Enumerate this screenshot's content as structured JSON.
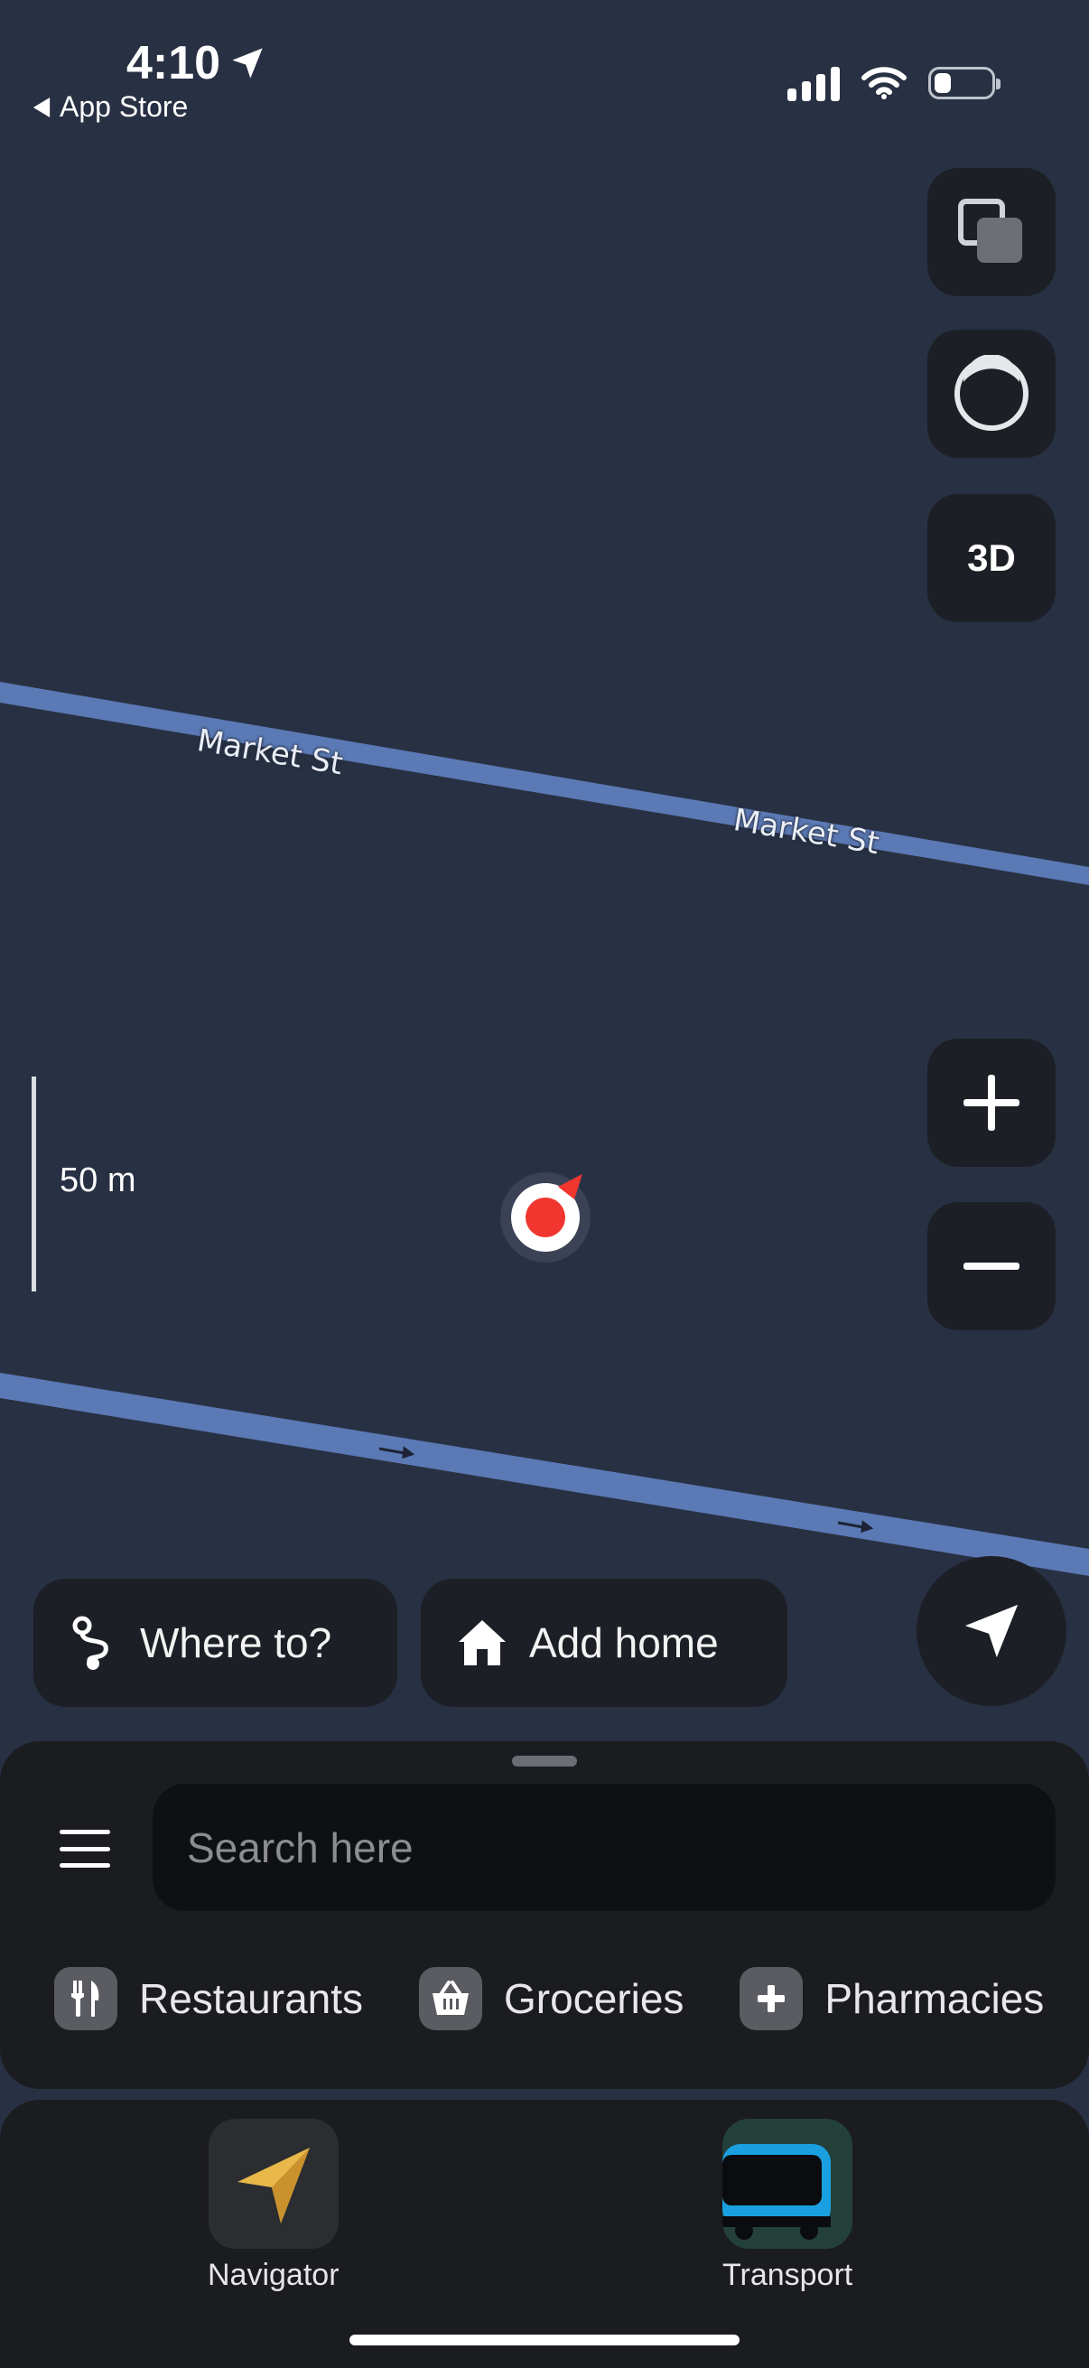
{
  "status_bar": {
    "time": "4:10",
    "back_app": "App Store",
    "battery_level": 0.25
  },
  "map": {
    "road_labels": [
      "Market St",
      "Market St"
    ],
    "scale": "50 m",
    "controls": {
      "layers_icon": "layers-icon",
      "style_icon": "circle-style-icon",
      "three_d": "3D",
      "zoom_in": "+",
      "zoom_out": "−"
    }
  },
  "actions": {
    "where_to": "Where to?",
    "add_home": "Add home"
  },
  "sheet": {
    "search_placeholder": "Search here",
    "categories": [
      {
        "label": "Restaurants",
        "icon": "fork-knife-icon"
      },
      {
        "label": "Groceries",
        "icon": "basket-icon"
      },
      {
        "label": "Pharmacies",
        "icon": "plus-icon"
      }
    ]
  },
  "dock": {
    "apps": [
      {
        "label": "Navigator"
      },
      {
        "label": "Transport"
      }
    ]
  },
  "colors": {
    "map_bg": "#283043",
    "road": "#5b79b4",
    "panel": "#1c1f25",
    "location_red": "#f0362f"
  }
}
